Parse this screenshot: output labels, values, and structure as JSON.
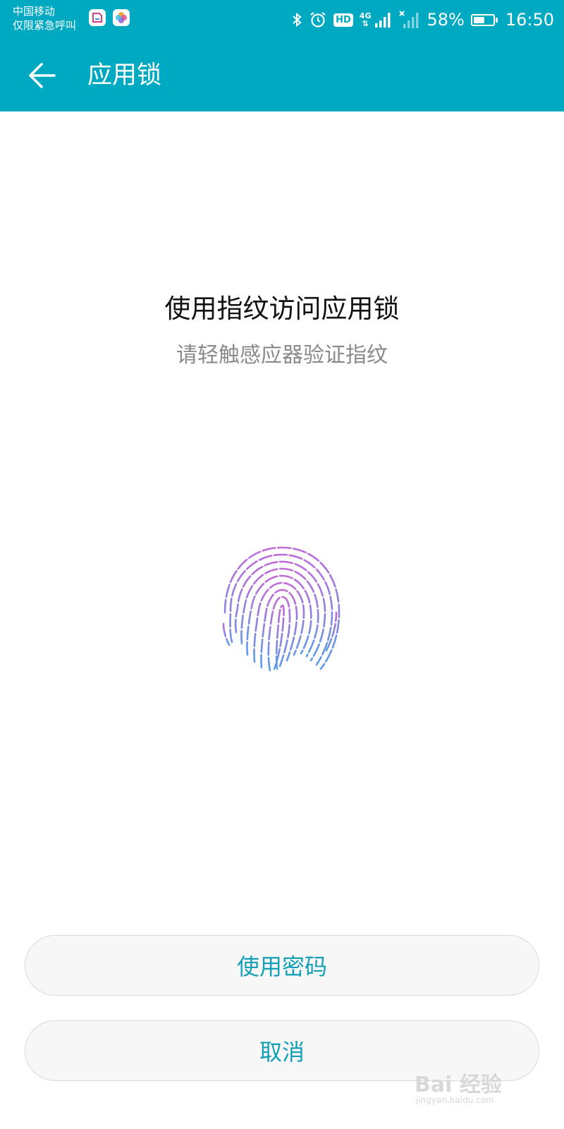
{
  "status_bar": {
    "carrier": "中国移动",
    "emergency": "仅限紧急呼叫",
    "hd": "HD",
    "network": "4G",
    "battery_percent": "58%",
    "battery_level": 0.58,
    "time": "16:50",
    "icons": [
      "bluetooth-icon",
      "alarm-icon",
      "signal-icon",
      "no-signal-icon",
      "battery-icon"
    ]
  },
  "toolbar": {
    "title": "应用锁",
    "back_icon": "arrow-left-icon"
  },
  "prompt": {
    "title": "使用指纹访问应用锁",
    "subtitle": "请轻触感应器验证指纹"
  },
  "fingerprint_icon": "fingerprint-icon",
  "buttons": {
    "use_password": "使用密码",
    "cancel": "取消"
  },
  "watermark": {
    "brand": "Bai 经验",
    "url": "jingyan.baidu.com"
  },
  "colors": {
    "accent": "#00a9c2",
    "button_text": "#139fb6",
    "gradient_top": "#c06bd8",
    "gradient_bottom": "#5b9de6"
  }
}
